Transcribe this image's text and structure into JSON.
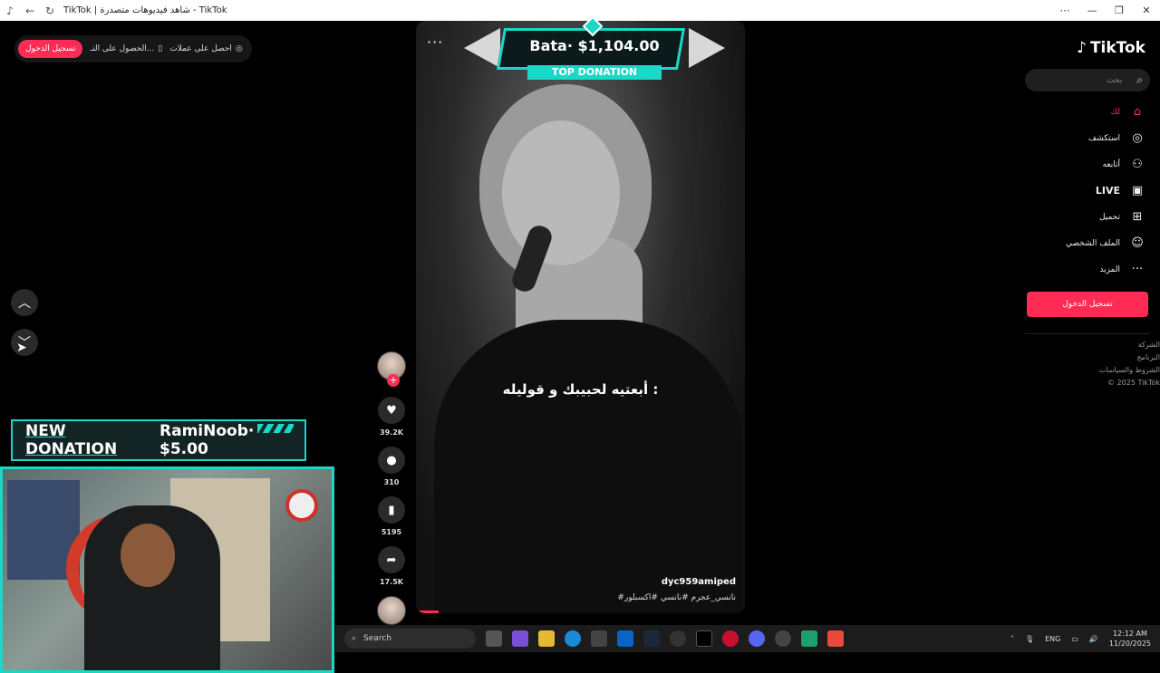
{
  "window": {
    "title": "TikTok | شاهد فيديوهات متصدرة - TikTok"
  },
  "topbar": {
    "login_label": "تسجيل الدخول",
    "get_app_label": "الحصول على التـ...",
    "coins_label": "احصل على عملات"
  },
  "overlay": {
    "top_donation_amount": "Bata· $1,104.00",
    "top_donation_label": "TOP DONATION",
    "new_donation_label": "NEW DONATION",
    "new_donation_text": "RamiNoob· $5.00"
  },
  "video": {
    "caption": "أبعتيه لحبيبك و قوليله :",
    "author": "dyc959amiped",
    "hashtags": "#نانسي_عجرم  #نانسي  #اكسبلور",
    "likes": "39.2K",
    "comments": "310",
    "saves": "5195",
    "shares": "17.5K"
  },
  "sidebar": {
    "brand": "TikTok",
    "search_placeholder": "بحث",
    "items": [
      {
        "label": "لك",
        "icon": "home-icon"
      },
      {
        "label": "استكشف",
        "icon": "compass-icon"
      },
      {
        "label": "أتابعه",
        "icon": "following-icon"
      },
      {
        "label": "LIVE",
        "icon": "live-icon"
      },
      {
        "label": "تحميل",
        "icon": "upload-icon"
      },
      {
        "label": "الملف الشخصي",
        "icon": "profile-icon"
      },
      {
        "label": "المزيد",
        "icon": "more-icon"
      }
    ],
    "login_button": "تسجيل الدخول",
    "footer": [
      "الشركة",
      "البرنامج",
      "الشروط والسياسات",
      "© 2025 TikTok"
    ]
  },
  "taskbar": {
    "search_label": "Search",
    "lang": "ENG",
    "time": "12:12 AM",
    "date": "11/20/2025"
  },
  "colors": {
    "accent": "#fe2c55",
    "overlay": "#1ad8c8"
  }
}
